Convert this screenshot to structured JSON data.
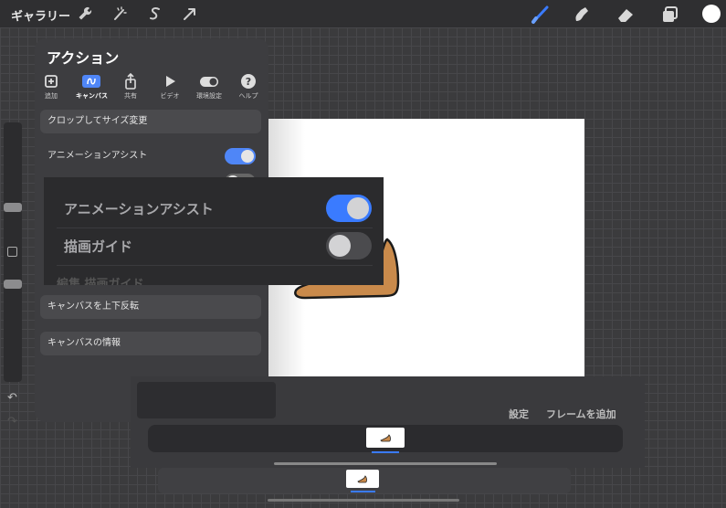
{
  "topbar": {
    "gallery_label": "ギャラリー",
    "left_tools": [
      "wrench-icon",
      "magic-wand-icon",
      "selection-s-icon",
      "transform-arrow-icon"
    ],
    "right_tools": [
      "brush-icon",
      "smudge-icon",
      "eraser-icon",
      "layers-icon"
    ],
    "accent_color": "#3a7bff",
    "current_color": "#ffffff"
  },
  "actions_panel": {
    "title": "アクション",
    "tabs": [
      {
        "label": "追加",
        "icon": "add-icon",
        "active": false
      },
      {
        "label": "キャンバス",
        "icon": "canvas-icon",
        "active": true
      },
      {
        "label": "共有",
        "icon": "share-icon",
        "active": false
      },
      {
        "label": "ビデオ",
        "icon": "play-icon",
        "active": false
      },
      {
        "label": "環境設定",
        "icon": "toggle-icon",
        "active": false
      },
      {
        "label": "ヘルプ",
        "icon": "help-icon",
        "active": false
      }
    ],
    "rows": [
      {
        "label": "クロップしてサイズ変更"
      },
      {
        "label": "アニメーションアシスト",
        "toggle": true
      },
      {
        "label": "キャンバスを上下反転"
      },
      {
        "label": "キャンバスの情報"
      }
    ]
  },
  "zoom_callout": {
    "animation_assist_label": "アニメーションアシスト",
    "animation_assist_on": true,
    "drawing_guide_label": "描画ガイド",
    "drawing_guide_on": false,
    "cut_off_label": "編集 描画ガイド"
  },
  "timeline": {
    "settings_label": "設定",
    "add_frame_label": "フレームを追加"
  }
}
